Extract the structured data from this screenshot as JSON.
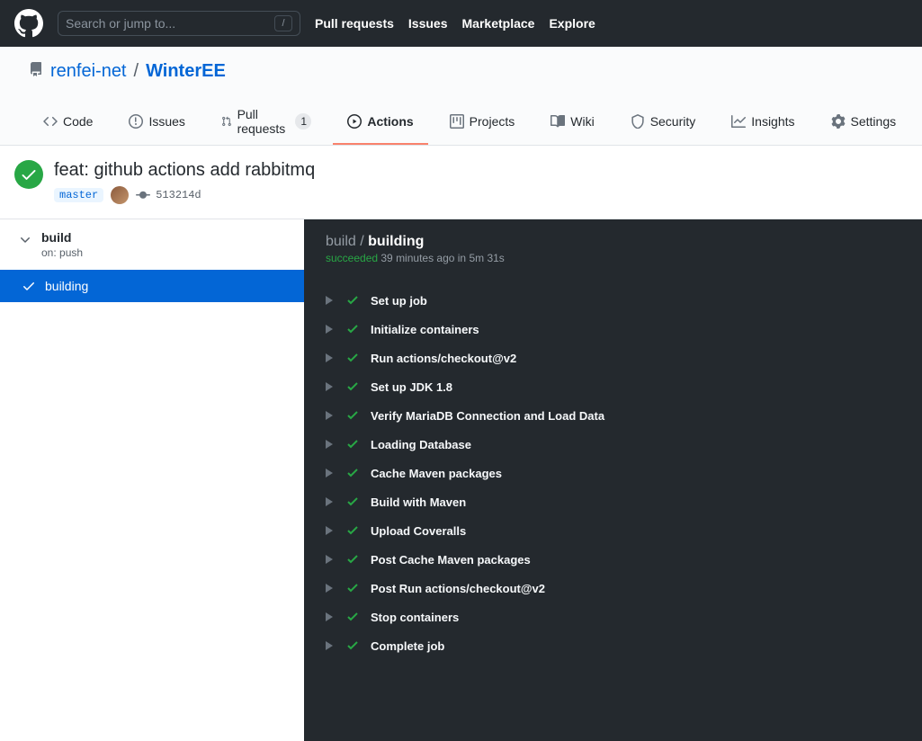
{
  "header": {
    "search_placeholder": "Search or jump to...",
    "search_key": "/",
    "links": [
      "Pull requests",
      "Issues",
      "Marketplace",
      "Explore"
    ]
  },
  "repo": {
    "owner": "renfei-net",
    "name": "WinterEE"
  },
  "tabs": [
    {
      "label": "Code",
      "icon": "code"
    },
    {
      "label": "Issues",
      "icon": "issue"
    },
    {
      "label": "Pull requests",
      "icon": "pr",
      "count": "1"
    },
    {
      "label": "Actions",
      "icon": "play",
      "active": true
    },
    {
      "label": "Projects",
      "icon": "project"
    },
    {
      "label": "Wiki",
      "icon": "book"
    },
    {
      "label": "Security",
      "icon": "shield"
    },
    {
      "label": "Insights",
      "icon": "graph"
    },
    {
      "label": "Settings",
      "icon": "gear"
    }
  ],
  "run": {
    "title": "feat: github actions add rabbitmq",
    "branch": "master",
    "sha": "513214d"
  },
  "sidebar": {
    "workflow": "build",
    "trigger": "on: push",
    "job": "building"
  },
  "log": {
    "workflow": "build",
    "job": "building",
    "status_word": "succeeded",
    "status_rest": " 39 minutes ago in 5m 31s",
    "steps": [
      "Set up job",
      "Initialize containers",
      "Run actions/checkout@v2",
      "Set up JDK 1.8",
      "Verify MariaDB Connection and Load Data",
      "Loading Database",
      "Cache Maven packages",
      "Build with Maven",
      "Upload Coveralls",
      "Post Cache Maven packages",
      "Post Run actions/checkout@v2",
      "Stop containers",
      "Complete job"
    ]
  }
}
